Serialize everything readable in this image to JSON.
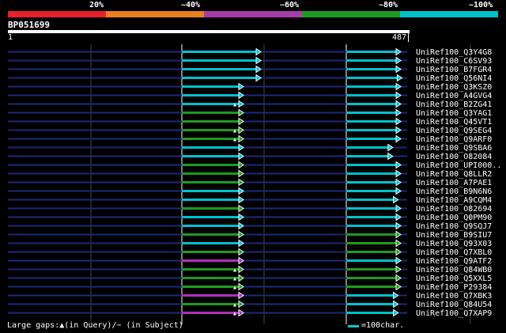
{
  "legend": {
    "labels": [
      "20%",
      "~40%",
      "~60%",
      "~80%",
      "~100%"
    ],
    "colors": [
      "#e8202a",
      "#e8801c",
      "#a43ca8",
      "#1e9b1e",
      "#00c0c8"
    ]
  },
  "query": {
    "name": "BP051699",
    "start": "1",
    "end": "487"
  },
  "footer": {
    "gaps_text": "Large gaps:▲(in Query)/− (in Subject)",
    "scale_text": "=100char."
  },
  "hits": [
    {
      "label": "UniRef100_Q3Y4G8",
      "segs": [
        [
          "cyan",
          0.9
        ],
        [
          "cyan",
          1.0
        ]
      ],
      "qgap": false
    },
    {
      "label": "UniRef100_C6SV93",
      "segs": [
        [
          "cyan",
          0.9
        ],
        [
          "cyan",
          1.0
        ]
      ],
      "qgap": false
    },
    {
      "label": "UniRef100_B7FGR4",
      "segs": [
        [
          "cyan",
          0.9
        ],
        [
          "cyan",
          1.0
        ]
      ],
      "qgap": false
    },
    {
      "label": "UniRef100_Q56NI4",
      "segs": [
        [
          "cyan",
          0.9
        ],
        [
          "cyan",
          1.02
        ]
      ],
      "qgap": false
    },
    {
      "label": "UniRef100_Q3KSZ0",
      "segs": [
        [
          "cyan",
          0.7
        ],
        [
          "cyan",
          1.0
        ]
      ],
      "qgap": false
    },
    {
      "label": "UniRef100_A4GVG4",
      "segs": [
        [
          "cyan",
          0.7
        ],
        [
          "cyan",
          1.0
        ]
      ],
      "qgap": false
    },
    {
      "label": "UniRef100_B2ZG41",
      "segs": [
        [
          "cyan",
          0.7
        ],
        [
          "cyan",
          1.0
        ]
      ],
      "qgap": true
    },
    {
      "label": "UniRef100_Q3YAG1",
      "segs": [
        [
          "green",
          0.7
        ],
        [
          "cyan",
          1.0
        ]
      ],
      "qgap": false
    },
    {
      "label": "UniRef100_Q45VT1",
      "segs": [
        [
          "green",
          0.7
        ],
        [
          "cyan",
          1.0
        ]
      ],
      "qgap": false
    },
    {
      "label": "UniRef100_Q9SEG4",
      "segs": [
        [
          "green",
          0.7
        ],
        [
          "cyan",
          1.0
        ]
      ],
      "qgap": true
    },
    {
      "label": "UniRef100_Q9ARF0",
      "segs": [
        [
          "green",
          0.7
        ],
        [
          "cyan",
          1.0
        ]
      ],
      "qgap": true
    },
    {
      "label": "UniRef100_Q9SBA6",
      "segs": [
        [
          "cyan",
          0.7
        ],
        [
          "cyan",
          0.85
        ]
      ],
      "qgap": false
    },
    {
      "label": "UniRef100_O82084",
      "segs": [
        [
          "cyan",
          0.7
        ],
        [
          "cyan",
          0.85
        ]
      ],
      "qgap": false
    },
    {
      "label": "UniRef100_UPI000..",
      "segs": [
        [
          "green",
          0.7
        ],
        [
          "cyan",
          1.0
        ]
      ],
      "qgap": false
    },
    {
      "label": "UniRef100_Q8LLR2",
      "segs": [
        [
          "green",
          0.7
        ],
        [
          "cyan",
          1.0
        ]
      ],
      "qgap": false
    },
    {
      "label": "UniRef100_A7PAE1",
      "segs": [
        [
          "green",
          0.7
        ],
        [
          "cyan",
          1.0
        ]
      ],
      "qgap": false
    },
    {
      "label": "UniRef100_B9N6N6",
      "segs": [
        [
          "cyan",
          0.7
        ],
        [
          "cyan",
          1.0
        ]
      ],
      "qgap": false
    },
    {
      "label": "UniRef100_A9CQM4",
      "segs": [
        [
          "cyan",
          0.7
        ],
        [
          "cyan",
          0.95
        ]
      ],
      "qgap": false
    },
    {
      "label": "UniRef100_O82694",
      "segs": [
        [
          "green",
          0.7
        ],
        [
          "cyan",
          1.0
        ]
      ],
      "qgap": false
    },
    {
      "label": "UniRef100_Q0PM90",
      "segs": [
        [
          "cyan",
          0.7
        ],
        [
          "cyan",
          1.0
        ]
      ],
      "qgap": false
    },
    {
      "label": "UniRef100_Q9SQJ7",
      "segs": [
        [
          "cyan",
          0.7
        ],
        [
          "cyan",
          1.0
        ]
      ],
      "qgap": false
    },
    {
      "label": "UniRef100_B9SIU7",
      "segs": [
        [
          "green",
          0.7
        ],
        [
          "green",
          1.0
        ]
      ],
      "qgap": false
    },
    {
      "label": "UniRef100_Q93X03",
      "segs": [
        [
          "cyan",
          0.7
        ],
        [
          "green",
          1.0
        ]
      ],
      "qgap": false
    },
    {
      "label": "UniRef100_Q7XBL0",
      "segs": [
        [
          "green",
          0.7
        ],
        [
          "green",
          1.0
        ]
      ],
      "qgap": false
    },
    {
      "label": "UniRef100_Q9ATF2",
      "segs": [
        [
          "magenta",
          0.7
        ],
        [
          "cyan",
          1.0
        ]
      ],
      "qgap": false
    },
    {
      "label": "UniRef100_Q84WB0",
      "segs": [
        [
          "green",
          0.7
        ],
        [
          "green",
          1.0
        ]
      ],
      "qgap": true
    },
    {
      "label": "UniRef100_Q5XXL5",
      "segs": [
        [
          "green",
          0.7
        ],
        [
          "green",
          1.0
        ]
      ],
      "qgap": true
    },
    {
      "label": "UniRef100_P29384",
      "segs": [
        [
          "green",
          0.7
        ],
        [
          "green",
          1.0
        ]
      ],
      "qgap": true
    },
    {
      "label": "UniRef100_Q7XBK3",
      "segs": [
        [
          "magenta",
          0.7
        ],
        [
          "cyan",
          0.95
        ]
      ],
      "qgap": false
    },
    {
      "label": "UniRef100_Q84U54",
      "segs": [
        [
          "green",
          0.7
        ],
        [
          "cyan",
          0.95
        ]
      ],
      "qgap": true
    },
    {
      "label": "UniRef100_Q7XAP9",
      "segs": [
        [
          "magenta",
          0.7
        ],
        [
          "cyan",
          0.95
        ]
      ],
      "qgap": true
    }
  ]
}
